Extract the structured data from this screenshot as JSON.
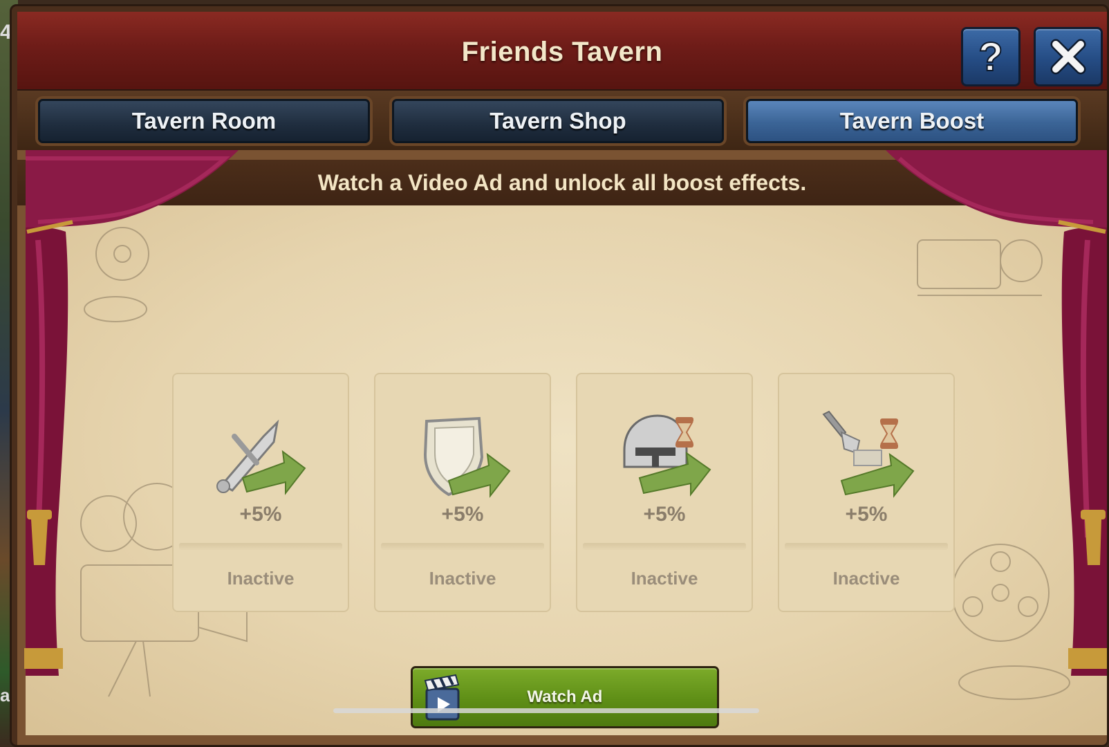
{
  "background": {
    "edge_digit": "4",
    "edge_letter": "a"
  },
  "window": {
    "title": "Friends Tavern",
    "help_label": "?",
    "close_label": "X"
  },
  "tabs": [
    {
      "label": "Tavern Room",
      "active": false
    },
    {
      "label": "Tavern Shop",
      "active": false
    },
    {
      "label": "Tavern Boost",
      "active": true
    }
  ],
  "banner": {
    "text": "Watch a Video Ad and unlock all boost effects."
  },
  "boosts": [
    {
      "icon": "attack-boost-icon",
      "value": "+5%",
      "status": "Inactive"
    },
    {
      "icon": "defense-boost-icon",
      "value": "+5%",
      "status": "Inactive"
    },
    {
      "icon": "recruit-speed-boost-icon",
      "value": "+5%",
      "status": "Inactive"
    },
    {
      "icon": "build-speed-boost-icon",
      "value": "+5%",
      "status": "Inactive"
    }
  ],
  "watch_ad": {
    "label": "Watch Ad",
    "icon": "clapperboard-icon"
  },
  "colors": {
    "title_red": "#6e1c18",
    "tab_blue": "#1f2d3e",
    "tab_active": "#3b6496",
    "parchment": "#e6d4ae",
    "watch_green": "#5e8e16",
    "curtain": "#8a1a46"
  }
}
